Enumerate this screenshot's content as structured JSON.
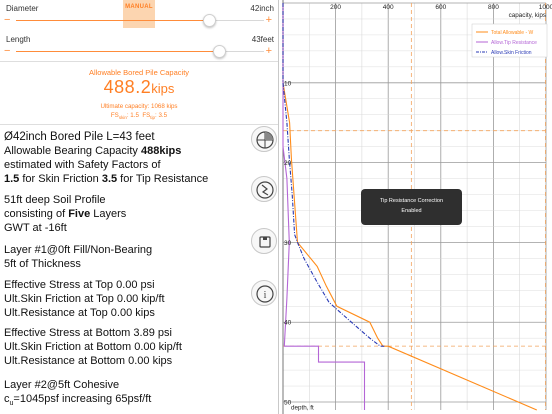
{
  "controls": {
    "diameter": {
      "label": "Diameter",
      "value": "42inch",
      "position": 0.78
    },
    "length": {
      "label": "Length",
      "value": "43feet",
      "position": 0.82
    },
    "mode_label": "MANUAL",
    "minus_symbol": "−",
    "plus_symbol": "+"
  },
  "summary": {
    "title": "Allowable Bored Pile Capacity",
    "value": "488.2",
    "unit": "kips",
    "ultimate": "Ultimate capacity: 1068 kips",
    "fs_prefix": "FS",
    "fs_skin_sub": "skin",
    "fs_skin_value": ": 1.5",
    "fs_tip_sub": "tip",
    "fs_tip_value": ": 3.5"
  },
  "report": {
    "heading": "Ø42inch Bored Pile L=43 feet",
    "cap_prefix": "Allowable Bearing Capacity ",
    "cap_value": "488kips",
    "est_line": "estimated with Safety Factors of",
    "sf_skin": "1.5",
    "sf_skin_text": " for Skin Friction ",
    "sf_tip": "3.5",
    "sf_tip_text": " for Tip Resistance",
    "profile_heading": "51ft deep Soil Profile",
    "consist_prefix": "consisting of ",
    "layer_count": "Five",
    "consist_suffix": " Layers",
    "gwt": "GWT at -16ft",
    "layer1_title": "Layer #1@0ft Fill/Non-Bearing",
    "layer1_thickness": "5ft of Thickness",
    "l1_lines": [
      "Effective Stress at Top 0.00 psi",
      "Ult.Skin Friction at Top 0.00 kip/ft",
      "Ult.Resistance at Top 0.00 kips",
      "Effective Stress at Bottom 3.89 psi",
      "Ult.Skin Friction at Bottom 0.00 kip/ft",
      "Ult.Resistance at Bottom 0.00 kips"
    ],
    "layer2_title": "Layer #2@5ft Cohesive",
    "layer2_c": "c",
    "layer2_sub": "u",
    "layer2_rest": "=1045psf increasing 65psf/ft"
  },
  "chart_data": {
    "type": "line",
    "x_ticks": [
      "200",
      "400",
      "600",
      "800",
      "1000"
    ],
    "y_ticks": [
      "10",
      "20",
      "30",
      "40",
      "50"
    ],
    "x_unit_label": "capacity, kips",
    "y_unit_label": "depth, ft",
    "xlim": [
      0,
      1000
    ],
    "ylim": [
      0,
      51
    ],
    "grid": true,
    "legend_placement": "top-right",
    "reference_lines": {
      "depth_gwt": 16,
      "depth_pile_tip": 43,
      "capacity_allowable": 488,
      "capacity_ultimate": 1068
    },
    "series": [
      {
        "name": "Total Allowable - W",
        "color": "#ff8c1a",
        "style": "solid",
        "x": [
          0,
          0,
          0,
          25,
          32,
          42,
          55,
          130,
          165,
          205,
          330,
          360,
          380,
          400,
          965
        ],
        "y": [
          0,
          5,
          10,
          15,
          19.5,
          24,
          30,
          33,
          35.5,
          38,
          40,
          42,
          43,
          43,
          51
        ]
      },
      {
        "name": "Allow.Tip Resistance",
        "color": "#b466d6",
        "style": "solid",
        "x": [
          0,
          0,
          0,
          15,
          24,
          15,
          5,
          135,
          135,
          310,
          310
        ],
        "y": [
          0,
          10,
          18,
          22,
          30,
          37,
          43,
          43,
          45,
          45,
          51
        ]
      },
      {
        "name": "Allow.Skin Friction",
        "color": "#2a3ab5",
        "style": "dash-dot",
        "x": [
          0,
          0,
          0,
          15,
          24,
          35,
          44,
          55,
          80,
          130,
          175,
          260,
          330,
          370,
          385
        ],
        "y": [
          0,
          5,
          10,
          15,
          19.5,
          24,
          29,
          30,
          32,
          35,
          37.5,
          40,
          42,
          43,
          43
        ]
      }
    ]
  },
  "toast": {
    "title": "Tip Resistance Correction",
    "status": "Enabled"
  },
  "buttons": [
    {
      "name": "soil-profile-icon"
    },
    {
      "name": "pile-shape-icon"
    },
    {
      "name": "save-icon"
    },
    {
      "name": "info-icon",
      "label": "i"
    }
  ]
}
